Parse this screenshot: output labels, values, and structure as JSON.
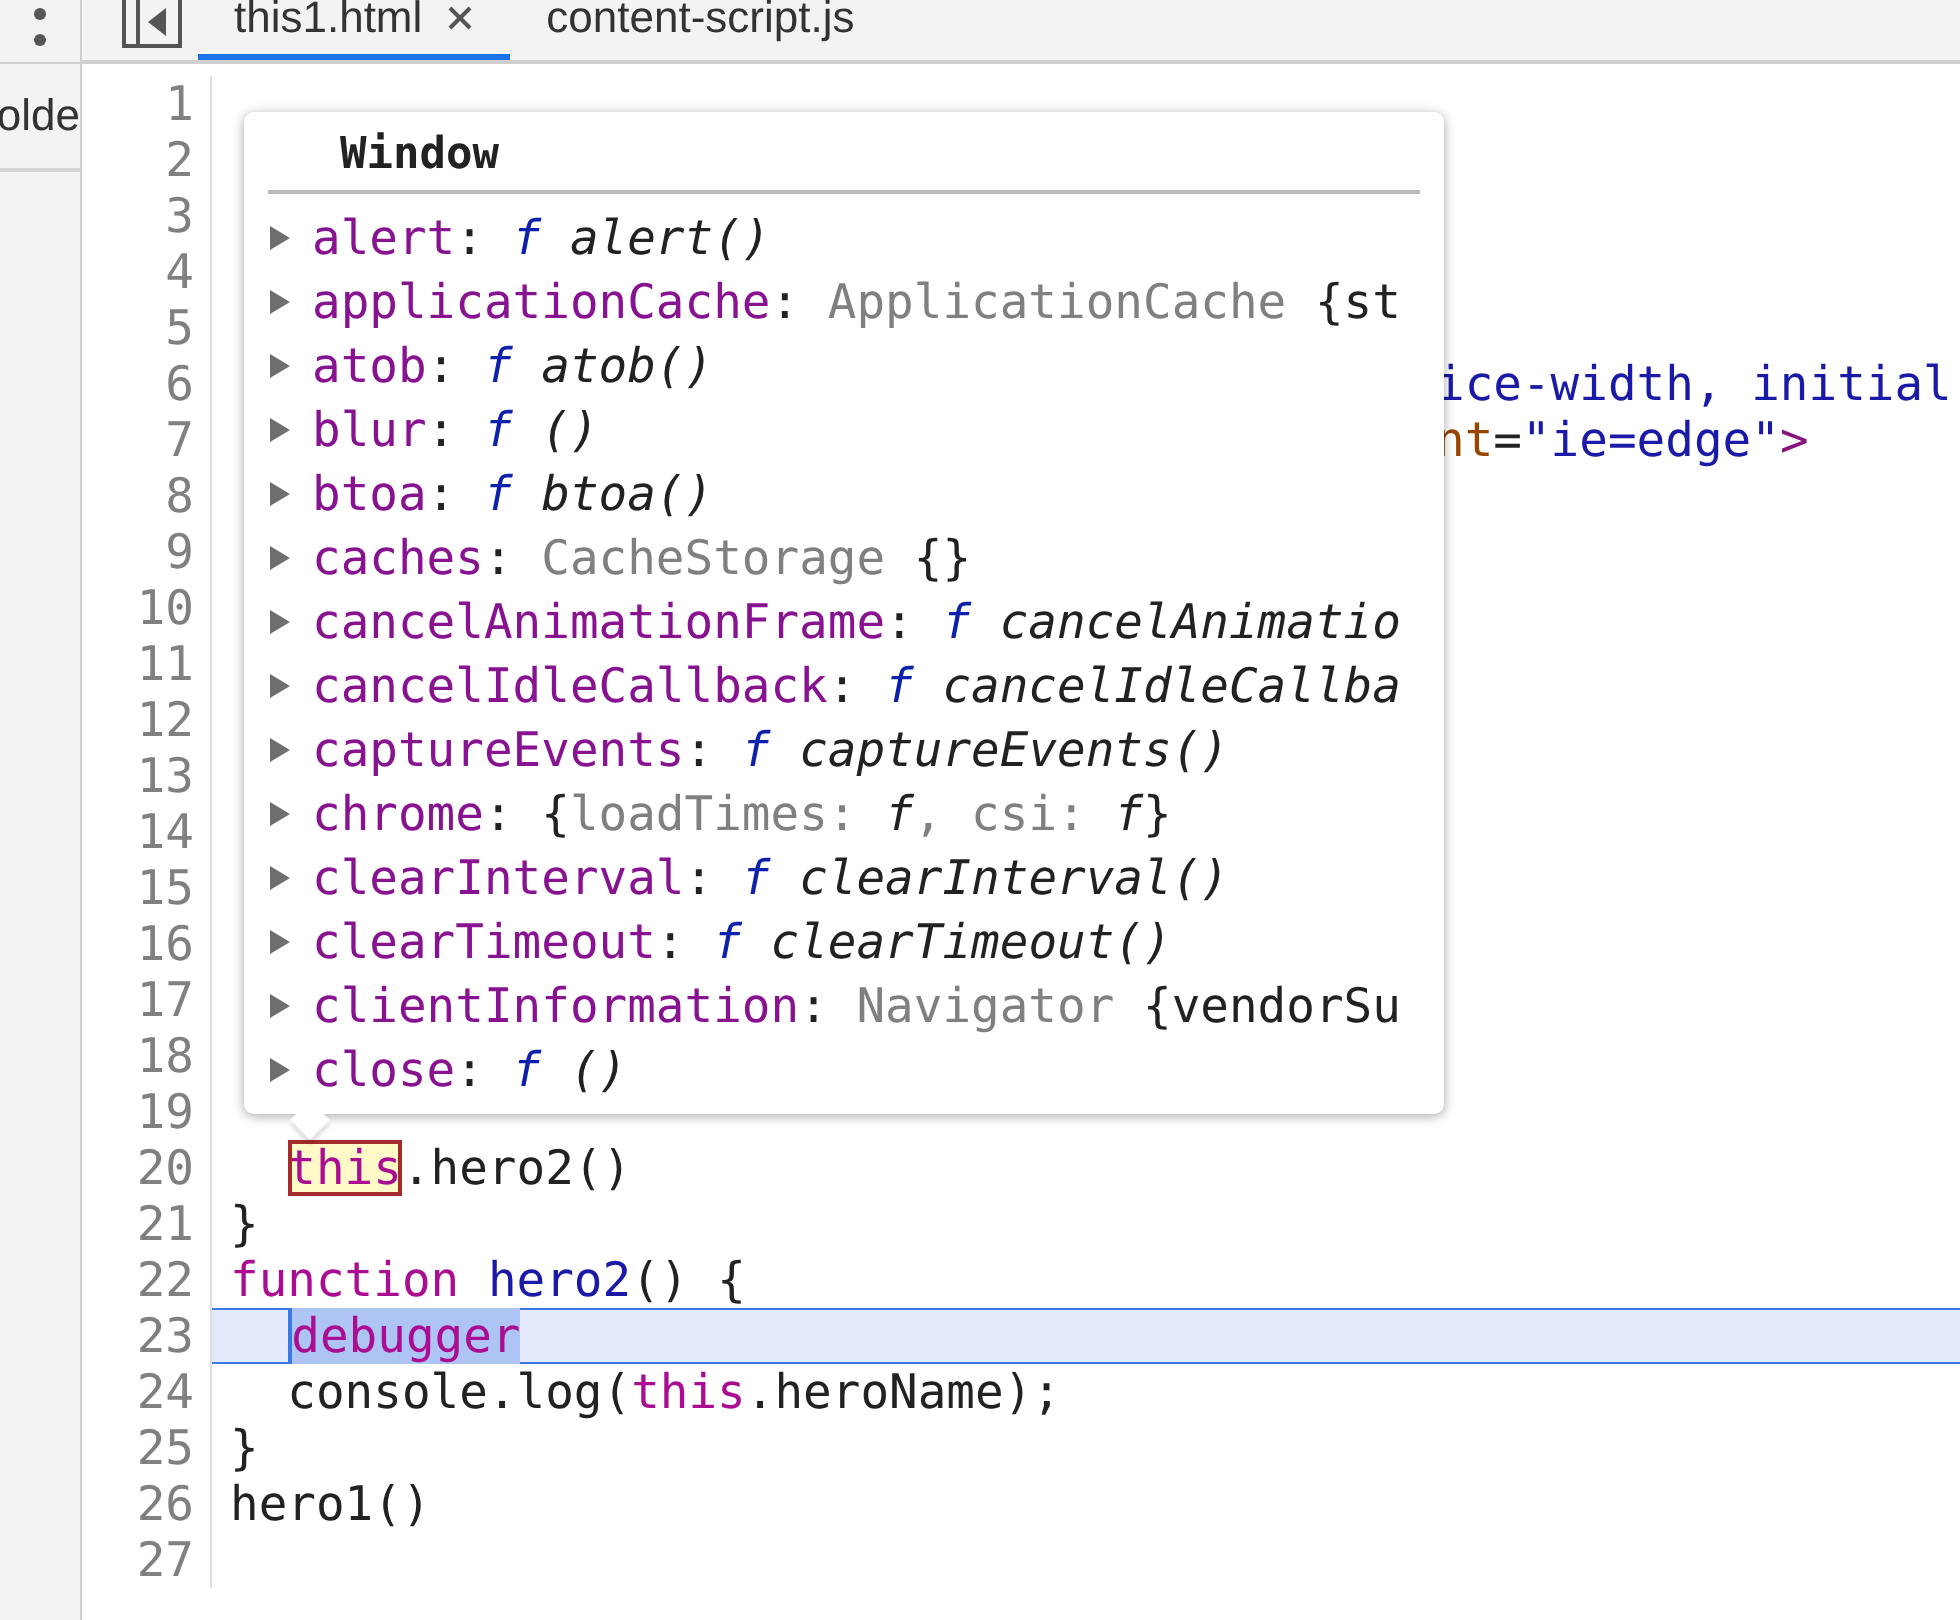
{
  "tabs": [
    {
      "label": "this1.html",
      "selected": true,
      "closable": true
    },
    {
      "label": "content-script.js",
      "selected": false,
      "closable": false
    }
  ],
  "sidebar": {
    "item": "olde"
  },
  "editor": {
    "lines": [
      {
        "number": "1"
      },
      {
        "number": "2"
      },
      {
        "number": "3"
      },
      {
        "number": "4"
      },
      {
        "number": "5"
      },
      {
        "number": "6",
        "beside_popup": [
          {
            "text": "ice-width, initial",
            "kind": "string"
          }
        ]
      },
      {
        "number": "7",
        "beside_popup": [
          {
            "text": "nt",
            "kind": "attr"
          },
          {
            "text": "=",
            "kind": "plain"
          },
          {
            "text": "\"ie=edge\"",
            "kind": "string"
          },
          {
            "text": ">",
            "kind": "tag"
          }
        ]
      },
      {
        "number": "8"
      },
      {
        "number": "9"
      },
      {
        "number": "10"
      },
      {
        "number": "11"
      },
      {
        "number": "12"
      },
      {
        "number": "13"
      },
      {
        "number": "14"
      },
      {
        "number": "15"
      },
      {
        "number": "16"
      },
      {
        "number": "17"
      },
      {
        "number": "18"
      },
      {
        "number": "19"
      },
      {
        "number": "20",
        "indented": true,
        "tokens": [
          {
            "text": "this",
            "kind": "keyword",
            "hovered": true
          },
          {
            "text": ".hero2()",
            "kind": "plain"
          }
        ]
      },
      {
        "number": "21",
        "tokens": [
          {
            "text": "}",
            "kind": "plain"
          }
        ]
      },
      {
        "number": "22",
        "tokens": [
          {
            "text": "function ",
            "kind": "keyword"
          },
          {
            "text": "hero2",
            "kind": "name"
          },
          {
            "text": "() {",
            "kind": "plain"
          }
        ]
      },
      {
        "number": "23",
        "current": true,
        "indented": true,
        "tokens": [
          {
            "text": "debugger",
            "kind": "keyword",
            "selected": true
          }
        ]
      },
      {
        "number": "24",
        "indented": true,
        "tokens": [
          {
            "text": "console.log(",
            "kind": "plain"
          },
          {
            "text": "this",
            "kind": "keyword"
          },
          {
            "text": ".heroName);",
            "kind": "plain"
          }
        ]
      },
      {
        "number": "25",
        "tokens": [
          {
            "text": "}",
            "kind": "plain"
          }
        ]
      },
      {
        "number": "26",
        "tokens": [
          {
            "text": "hero1()",
            "kind": "plain"
          }
        ]
      },
      {
        "number": "27"
      }
    ]
  },
  "popup": {
    "title": "Window",
    "properties": [
      {
        "name": "alert",
        "value": [
          {
            "text": ": ",
            "kind": "plain"
          },
          {
            "text": "f",
            "kind": "f"
          },
          {
            "text": " alert()",
            "kind": "fn"
          }
        ]
      },
      {
        "name": "applicationCache",
        "value": [
          {
            "text": ": ",
            "kind": "plain"
          },
          {
            "text": "ApplicationCache",
            "kind": "type"
          },
          {
            "text": " {st",
            "kind": "plain"
          }
        ]
      },
      {
        "name": "atob",
        "value": [
          {
            "text": ": ",
            "kind": "plain"
          },
          {
            "text": "f",
            "kind": "f"
          },
          {
            "text": " atob()",
            "kind": "fn"
          }
        ]
      },
      {
        "name": "blur",
        "value": [
          {
            "text": ": ",
            "kind": "plain"
          },
          {
            "text": "f",
            "kind": "f"
          },
          {
            "text": " ()",
            "kind": "fn"
          }
        ]
      },
      {
        "name": "btoa",
        "value": [
          {
            "text": ": ",
            "kind": "plain"
          },
          {
            "text": "f",
            "kind": "f"
          },
          {
            "text": " btoa()",
            "kind": "fn"
          }
        ]
      },
      {
        "name": "caches",
        "value": [
          {
            "text": ": ",
            "kind": "plain"
          },
          {
            "text": "CacheStorage",
            "kind": "type"
          },
          {
            "text": " {}",
            "kind": "plain"
          }
        ]
      },
      {
        "name": "cancelAnimationFrame",
        "value": [
          {
            "text": ": ",
            "kind": "plain"
          },
          {
            "text": "f",
            "kind": "f"
          },
          {
            "text": " cancelAnimatio",
            "kind": "fn"
          }
        ]
      },
      {
        "name": "cancelIdleCallback",
        "value": [
          {
            "text": ": ",
            "kind": "plain"
          },
          {
            "text": "f",
            "kind": "f"
          },
          {
            "text": " cancelIdleCallba",
            "kind": "fn"
          }
        ]
      },
      {
        "name": "captureEvents",
        "value": [
          {
            "text": ": ",
            "kind": "plain"
          },
          {
            "text": "f",
            "kind": "f"
          },
          {
            "text": " captureEvents()",
            "kind": "fn"
          }
        ]
      },
      {
        "name": "chrome",
        "value": [
          {
            "text": ": ",
            "kind": "plain"
          },
          {
            "text": "{",
            "kind": "plain"
          },
          {
            "text": "loadTimes: ",
            "kind": "type"
          },
          {
            "text": "f",
            "kind": "fn"
          },
          {
            "text": ", csi: ",
            "kind": "type"
          },
          {
            "text": "f",
            "kind": "fn"
          },
          {
            "text": "}",
            "kind": "plain"
          }
        ]
      },
      {
        "name": "clearInterval",
        "value": [
          {
            "text": ": ",
            "kind": "plain"
          },
          {
            "text": "f",
            "kind": "f"
          },
          {
            "text": " clearInterval()",
            "kind": "fn"
          }
        ]
      },
      {
        "name": "clearTimeout",
        "value": [
          {
            "text": ": ",
            "kind": "plain"
          },
          {
            "text": "f",
            "kind": "f"
          },
          {
            "text": " clearTimeout()",
            "kind": "fn"
          }
        ]
      },
      {
        "name": "clientInformation",
        "value": [
          {
            "text": ": ",
            "kind": "plain"
          },
          {
            "text": "Navigator",
            "kind": "type"
          },
          {
            "text": " {vendorSu",
            "kind": "plain"
          }
        ]
      },
      {
        "name": "close",
        "value": [
          {
            "text": ": ",
            "kind": "plain"
          },
          {
            "text": "f",
            "kind": "f"
          },
          {
            "text": " ()",
            "kind": "fn"
          }
        ]
      }
    ]
  }
}
